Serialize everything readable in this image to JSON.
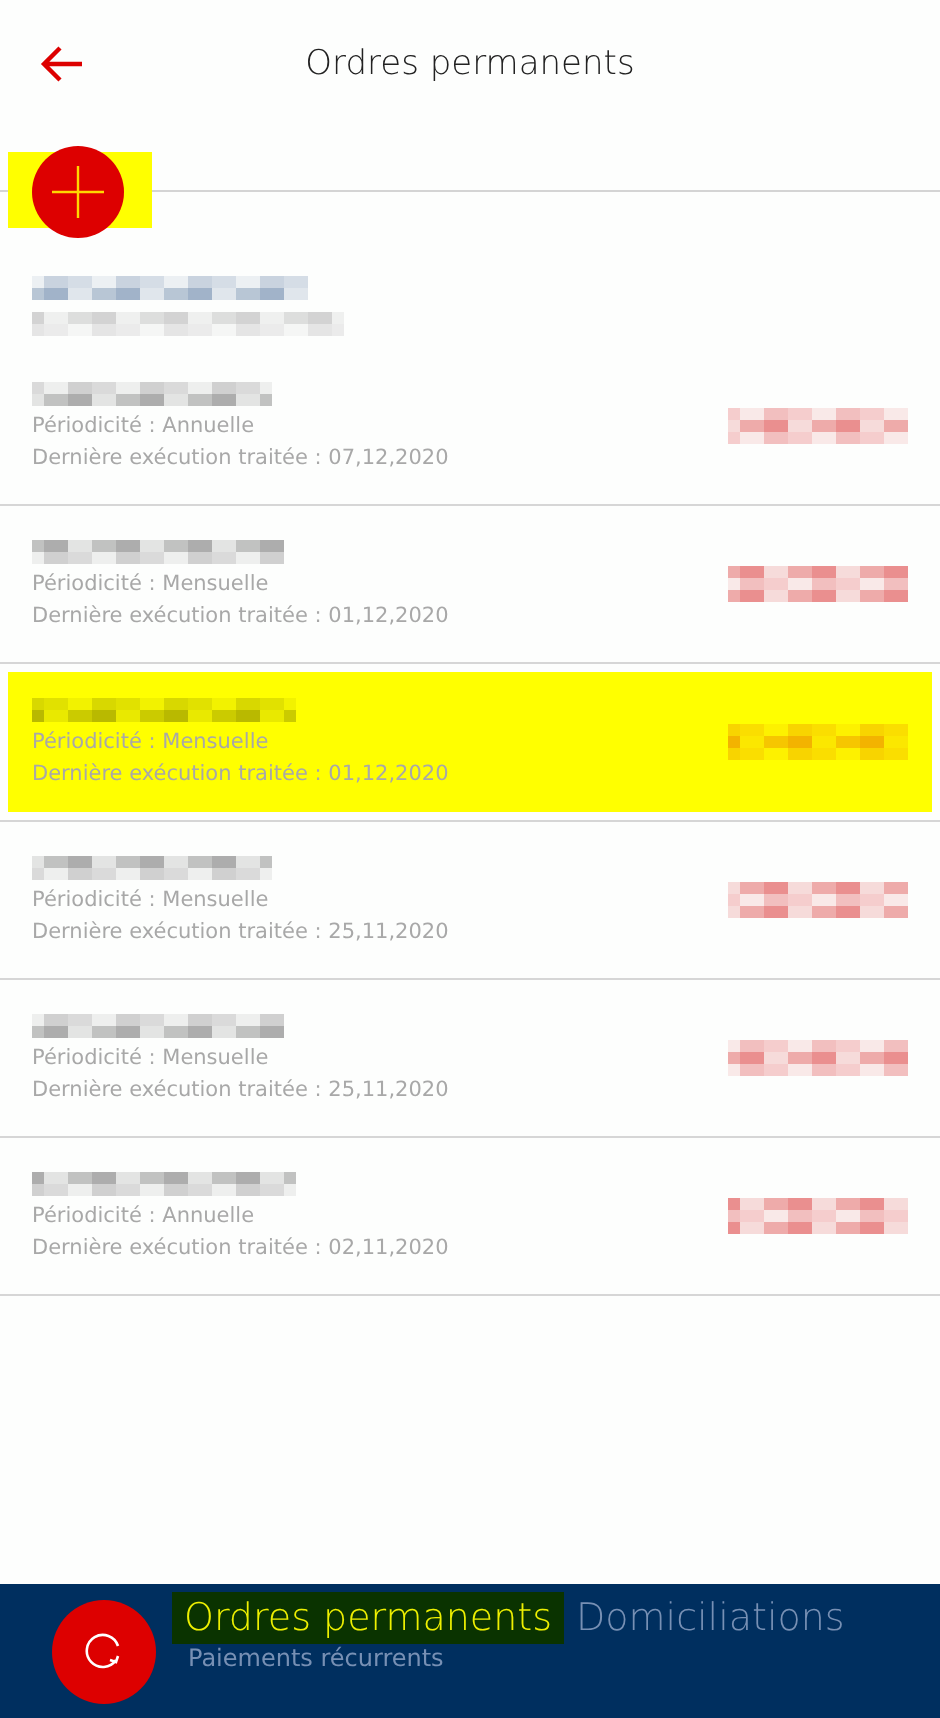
{
  "header": {
    "title": "Ordres permanents"
  },
  "add_button": {
    "highlighted": true
  },
  "orders": [
    {
      "periodicity": "Périodicité : Annuelle",
      "last_execution": "Dernière exécution traitée : 07,12,2020",
      "highlighted": false
    },
    {
      "periodicity": "Périodicité : Mensuelle",
      "last_execution": "Dernière exécution traitée : 01,12,2020",
      "highlighted": false
    },
    {
      "periodicity": "Périodicité : Mensuelle",
      "last_execution": "Dernière exécution traitée : 01,12,2020",
      "highlighted": true
    },
    {
      "periodicity": "Périodicité : Mensuelle",
      "last_execution": "Dernière exécution traitée : 25,11,2020",
      "highlighted": false
    },
    {
      "periodicity": "Périodicité : Mensuelle",
      "last_execution": "Dernière exécution traitée : 25,11,2020",
      "highlighted": false
    },
    {
      "periodicity": "Périodicité : Annuelle",
      "last_execution": "Dernière exécution traitée : 02,11,2020",
      "highlighted": false
    }
  ],
  "bottom_nav": {
    "tabs": [
      {
        "label": "Ordres permanents",
        "sublabel": "Paiements récurrents",
        "selected": true
      },
      {
        "label": "Domiciliations",
        "selected": false
      }
    ]
  }
}
